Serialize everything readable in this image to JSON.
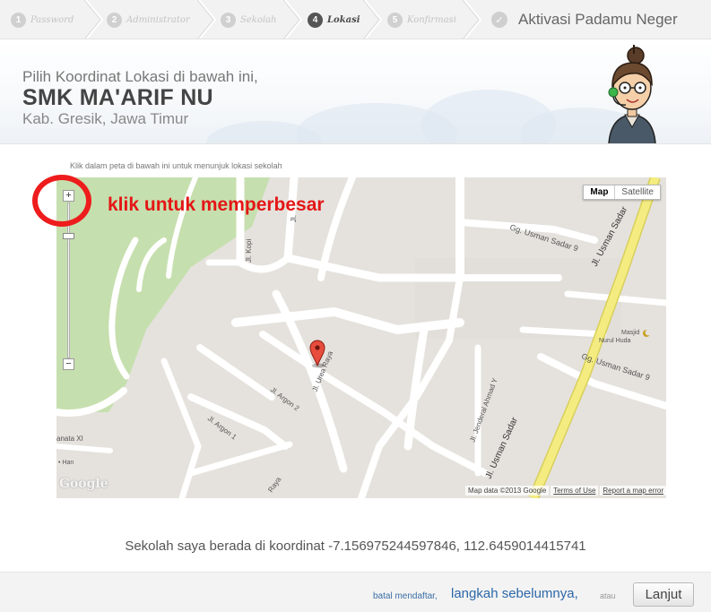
{
  "steps": [
    {
      "num": "1",
      "label": "Password",
      "active": false
    },
    {
      "num": "2",
      "label": "Administrator",
      "active": false
    },
    {
      "num": "3",
      "label": "Sekolah",
      "active": false
    },
    {
      "num": "4",
      "label": "Lokasi",
      "active": true
    },
    {
      "num": "5",
      "label": "Konfirmasi",
      "active": false
    }
  ],
  "brand": {
    "check": "✓",
    "title": "Aktivasi Padamu Neger"
  },
  "header": {
    "line1": "Pilih Koordinat Lokasi di bawah ini,",
    "school": "SMK MA'ARIF NU",
    "location": "Kab. Gresik, Jawa Timur"
  },
  "map": {
    "instruction": "Klik dalam peta di bawah ini untuk menunjuk lokasi sekolah",
    "type_map": "Map",
    "type_satellite": "Satellite",
    "zoom_in": "+",
    "zoom_out": "−",
    "google": "Google",
    "copyright": "Map data ©2013 Google",
    "terms": "Terms of Use",
    "report": "Report a map error",
    "labels": {
      "usman_sadar_9_a": "Gg. Usman Sadar 9",
      "usman_sadar_9_b": "Gg. Usman Sadar 9",
      "usman_sadar_main": "Jl. Usman Sadar",
      "usman_sadar_lower": "Jl. Usman Sadar",
      "masjid": "Masjid",
      "nurul_huda": "Nurul Huda",
      "jenderal_ahmad": "Jl. Jenderal Ahmad Y",
      "kopi": "Jl. Kopi",
      "jl_a": "Jl.",
      "urea": "Jl. Urea Raya",
      "argon2": "Jl. Argon 2",
      "argon1": "Jl. Argon 1",
      "anata": "anata XI",
      "han": "• Han",
      "raya": "Raya"
    }
  },
  "annotation": {
    "text": "klik untuk memperbesar"
  },
  "coords": {
    "text": "Sekolah saya berada di koordinat -7.156975244597846, 112.6459014415741"
  },
  "footer": {
    "cancel": "batal mendaftar,",
    "prev": "langkah sebelumnya,",
    "or": "atau",
    "next": "Lanjut"
  },
  "colors": {
    "annotation_red": "#e41616",
    "link_blue": "#2d68a8",
    "map_road": "#ffffff",
    "map_main_road": "#f4ec80",
    "map_park": "#c6dfae"
  }
}
